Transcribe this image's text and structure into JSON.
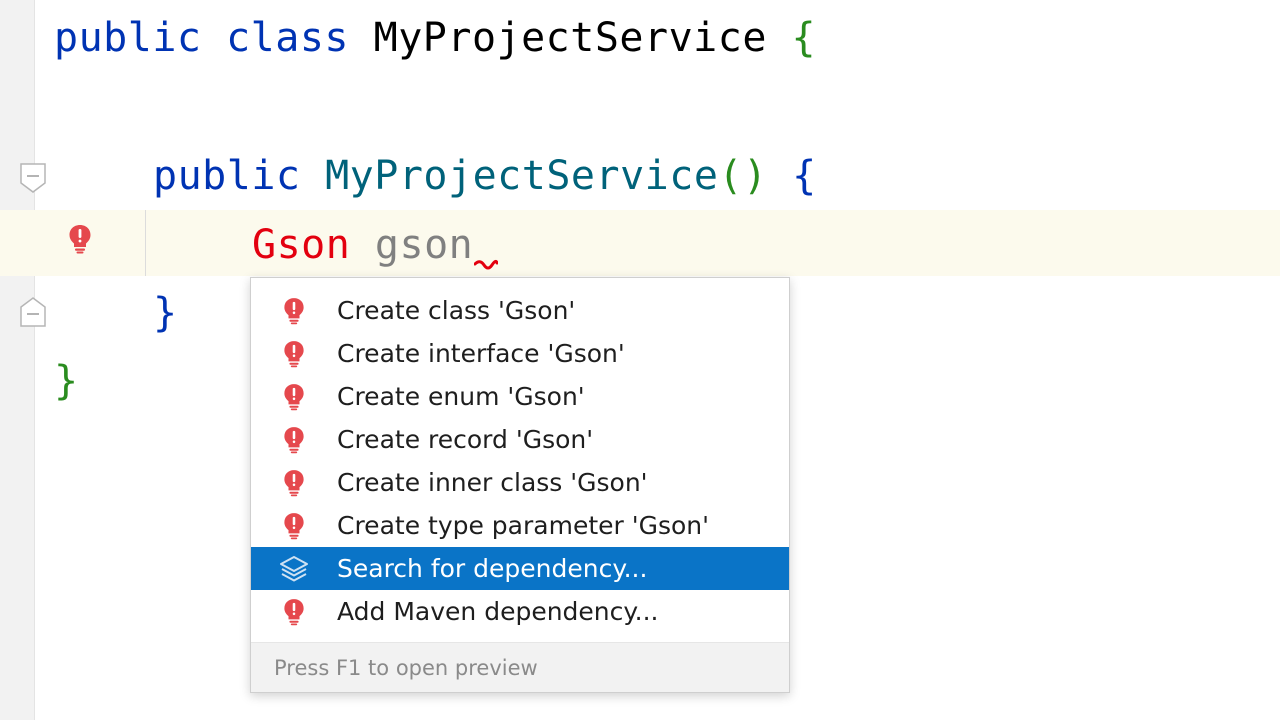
{
  "editor": {
    "lines": {
      "class_decl": {
        "kw_public": "public",
        "kw_class": "class",
        "name": "MyProjectService",
        "brace": "{"
      },
      "ctor_decl": {
        "kw_public": "public",
        "name": "MyProjectService",
        "parens": "()",
        "brace": "{"
      },
      "stmt": {
        "type": "Gson",
        "var": "gson"
      },
      "ctor_close": "}",
      "class_close": "}"
    }
  },
  "popup": {
    "items": [
      {
        "label": "Create class 'Gson'",
        "icon": "error-bulb-icon"
      },
      {
        "label": "Create interface 'Gson'",
        "icon": "error-bulb-icon"
      },
      {
        "label": "Create enum 'Gson'",
        "icon": "error-bulb-icon"
      },
      {
        "label": "Create record 'Gson'",
        "icon": "error-bulb-icon"
      },
      {
        "label": "Create inner class 'Gson'",
        "icon": "error-bulb-icon"
      },
      {
        "label": "Create type parameter 'Gson'",
        "icon": "error-bulb-icon"
      },
      {
        "label": "Search for dependency...",
        "icon": "layers-icon",
        "selected": true
      },
      {
        "label": "Add Maven dependency...",
        "icon": "error-bulb-icon"
      }
    ],
    "footer": "Press F1 to open preview"
  },
  "colors": {
    "keyword": "#0033b3",
    "method": "#00627a",
    "error": "#e3000f",
    "selection": "#0a74c7",
    "bulb": "#e5484d"
  }
}
